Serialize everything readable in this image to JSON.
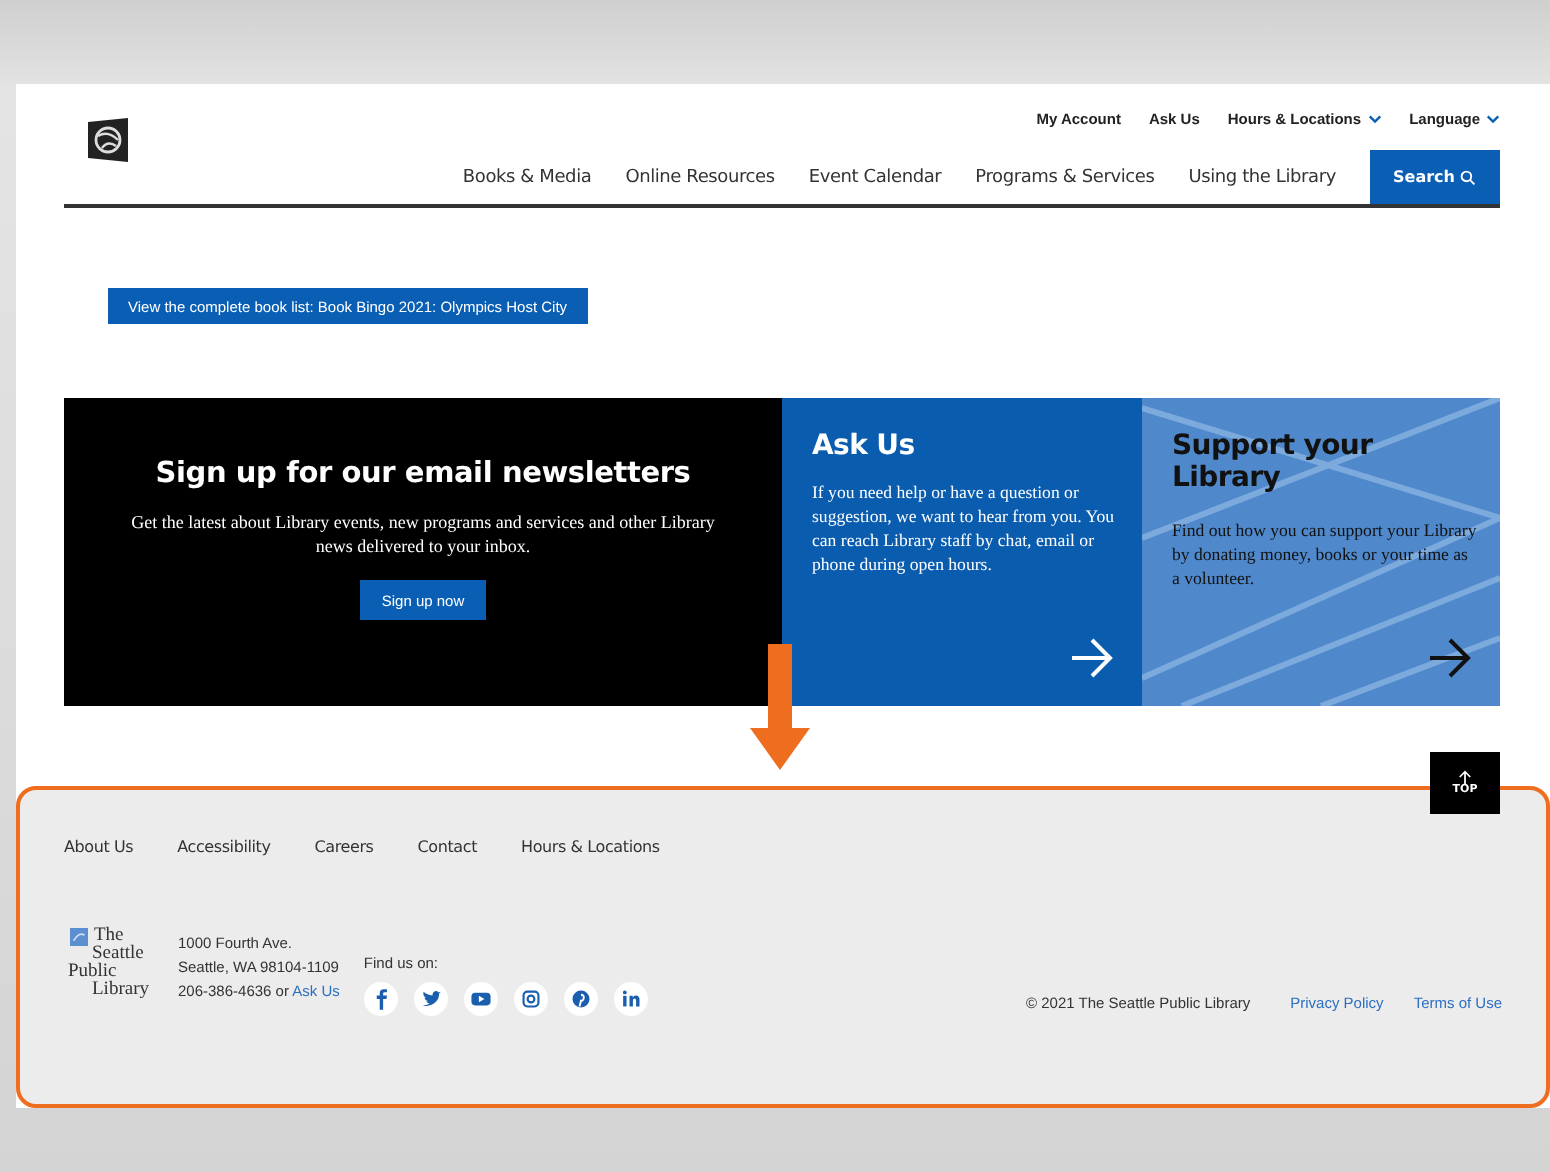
{
  "header": {
    "top_links": [
      {
        "label": "My Account",
        "dropdown": false
      },
      {
        "label": "Ask Us",
        "dropdown": false
      },
      {
        "label": "Hours & Locations",
        "dropdown": true
      },
      {
        "label": "Language",
        "dropdown": true
      }
    ],
    "nav": [
      "Books & Media",
      "Online Resources",
      "Event Calendar",
      "Programs & Services",
      "Using the Library"
    ],
    "search_button": "Search"
  },
  "book_list_button": "View the complete book list: Book Bingo 2021: Olympics Host City",
  "promos": [
    {
      "kind": "newsletter",
      "title": "Sign up for our email newsletters",
      "text": "Get the latest about Library events, new programs and services and other Library news delivered to your inbox.",
      "button": "Sign up now"
    },
    {
      "kind": "ask",
      "title": "Ask Us",
      "text": "If you need help or have a question or suggestion, we want to hear from you. You can reach Library staff by chat, email or phone during open hours."
    },
    {
      "kind": "support",
      "title": "Support your Library",
      "text": "Find out how you can support your Library by donating money, books or your time as a volunteer."
    }
  ],
  "back_to_top": "TOP",
  "footer": {
    "links": [
      "About Us",
      "Accessibility",
      "Careers",
      "Contact",
      "Hours & Locations"
    ],
    "logo": [
      "The",
      "Seattle",
      "Public",
      "Library"
    ],
    "address": [
      "1000 Fourth Ave.",
      "Seattle, WA 98104-1109"
    ],
    "phone": "206-386-4636 or",
    "ask_link": "Ask Us",
    "find_us": "Find us on:",
    "social": [
      {
        "kind": "facebook"
      },
      {
        "kind": "twitter"
      },
      {
        "kind": "youtube"
      },
      {
        "kind": "instagram"
      },
      {
        "kind": "pinterest"
      },
      {
        "kind": "linkedin"
      }
    ],
    "copyright": "© 2021 The Seattle Public Library",
    "legal_links": [
      "Privacy Policy",
      "Terms of Use"
    ]
  }
}
